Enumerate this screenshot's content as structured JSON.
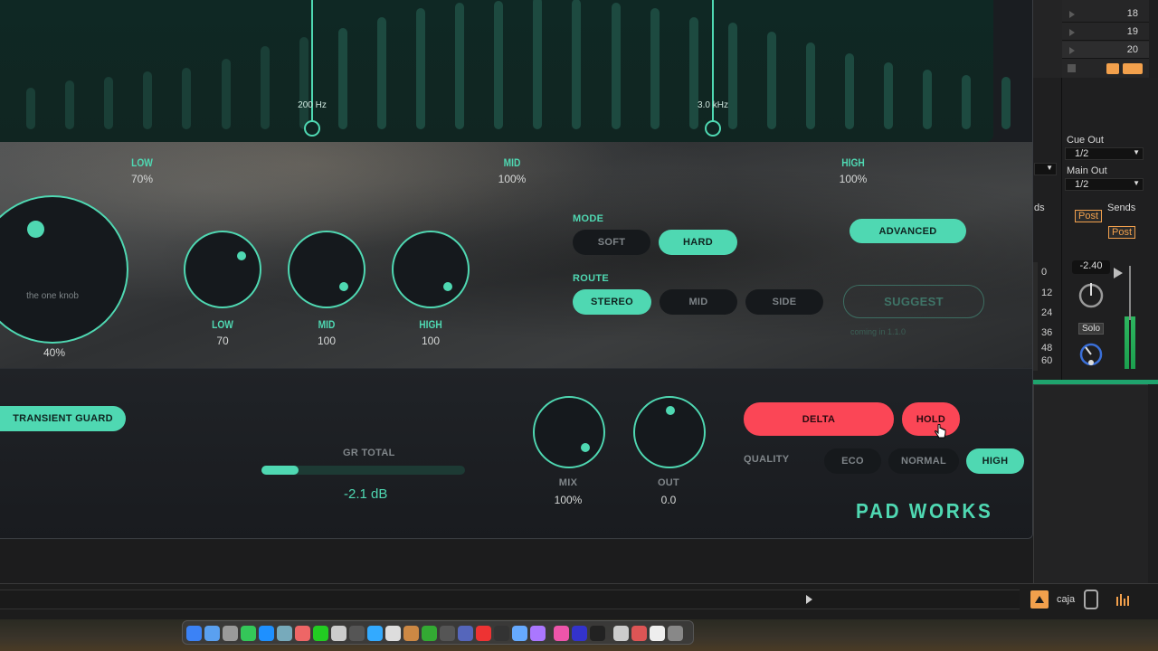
{
  "spectrum": {
    "crossover_low": "200 Hz",
    "crossover_high": "3.0 kHz"
  },
  "bands": {
    "low": {
      "label": "LOW",
      "value": "70%"
    },
    "mid": {
      "label": "MID",
      "value": "100%"
    },
    "high": {
      "label": "HIGH",
      "value": "100%"
    }
  },
  "one_knob": {
    "label": "the one knob",
    "value": "40%"
  },
  "band_knobs": [
    {
      "label": "LOW",
      "value": "70"
    },
    {
      "label": "MID",
      "value": "100"
    },
    {
      "label": "HIGH",
      "value": "100"
    }
  ],
  "mode": {
    "label": "MODE",
    "options": [
      "SOFT",
      "HARD"
    ],
    "selected": "HARD"
  },
  "route": {
    "label": "ROUTE",
    "options": [
      "STEREO",
      "MID",
      "SIDE"
    ],
    "selected": "STEREO"
  },
  "advanced_label": "ADVANCED",
  "suggest": {
    "label": "SUGGEST",
    "note": "coming in 1.1.0"
  },
  "transient_guard_label": "TRANSIENT GUARD",
  "gr": {
    "label": "GR TOTAL",
    "value": "-2.1 dB",
    "fill": 0.18
  },
  "mix": {
    "label": "MIX",
    "value": "100%"
  },
  "out": {
    "label": "OUT",
    "value": "0.0"
  },
  "delta_label": "DELTA",
  "hold_label": "HOLD",
  "quality": {
    "label": "QUALITY",
    "options": [
      "ECO",
      "NORMAL",
      "HIGH"
    ],
    "selected": "HIGH"
  },
  "brand": "PAD WORKS",
  "ableton": {
    "rows": [
      "18",
      "19",
      "20"
    ],
    "cue_out": {
      "label": "Cue Out",
      "value": "1/2"
    },
    "main_out": {
      "label": "Main Out",
      "value": "1/2"
    },
    "sends_partial": "ds",
    "sends": "Sends",
    "post1": "Post",
    "post2": "Post",
    "scale": [
      "0",
      "12",
      "24",
      "36",
      "48",
      "60"
    ],
    "volume": "-2.40",
    "solo": "Solo",
    "user": "caja"
  },
  "colors": {
    "accent": "#4fd8b2",
    "red": "#fb4656",
    "orange": "#f2a04c"
  }
}
